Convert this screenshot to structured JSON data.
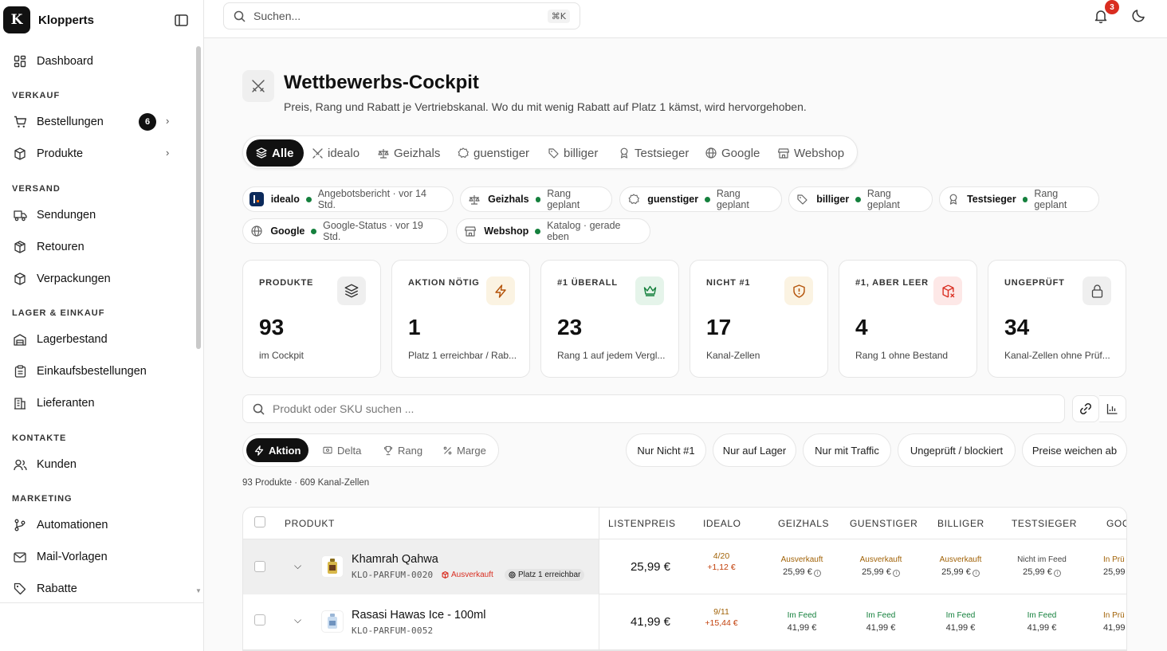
{
  "app": {
    "name": "Klopperts",
    "logo_letter": "K"
  },
  "sidebar": {
    "items": [
      {
        "label": "Dashboard"
      },
      {
        "label": "Bestellungen",
        "badge": "6"
      },
      {
        "label": "Produkte"
      },
      {
        "label": "Sendungen"
      },
      {
        "label": "Retouren"
      },
      {
        "label": "Verpackungen"
      },
      {
        "label": "Lagerbestand"
      },
      {
        "label": "Einkaufsbestellungen"
      },
      {
        "label": "Lieferanten"
      },
      {
        "label": "Kunden"
      },
      {
        "label": "Automationen"
      },
      {
        "label": "Mail-Vorlagen"
      },
      {
        "label": "Rabatte"
      }
    ],
    "sections": [
      "VERKAUF",
      "VERSAND",
      "LAGER & EINKAUF",
      "KONTAKTE",
      "MARKETING"
    ]
  },
  "topbar": {
    "search_placeholder": "Suchen...",
    "shortcut": "⌘K",
    "notifications": "3"
  },
  "header": {
    "title": "Wettbewerbs-Cockpit",
    "subtitle": "Preis, Rang und Rabatt je Vertriebskanal. Wo du mit wenig Rabatt auf Platz 1 kämst, wird hervorgehoben."
  },
  "tabs": [
    "Alle",
    "idealo",
    "Geizhals",
    "guenstiger",
    "billiger",
    "Testsieger",
    "Google",
    "Webshop"
  ],
  "chips": [
    {
      "name": "idealo",
      "status": "Angebotsbericht · vor 14 Std."
    },
    {
      "name": "Geizhals",
      "status": "Rang geplant"
    },
    {
      "name": "guenstiger",
      "status": "Rang geplant"
    },
    {
      "name": "billiger",
      "status": "Rang geplant"
    },
    {
      "name": "Testsieger",
      "status": "Rang geplant"
    },
    {
      "name": "Google",
      "status": "Google-Status · vor 19 Std."
    },
    {
      "name": "Webshop",
      "status": "Katalog · gerade eben"
    }
  ],
  "kpis": [
    {
      "label": "PRODUKTE",
      "value": "93",
      "sub": "im Cockpit"
    },
    {
      "label": "AKTION NÖTIG",
      "value": "1",
      "sub": "Platz 1 erreichbar / Rab..."
    },
    {
      "label": "#1 ÜBERALL",
      "value": "23",
      "sub": "Rang 1 auf jedem Vergl..."
    },
    {
      "label": "NICHT #1",
      "value": "17",
      "sub": "Kanal-Zellen"
    },
    {
      "label": "#1, ABER LEER",
      "value": "4",
      "sub": "Rang 1 ohne Bestand"
    },
    {
      "label": "UNGEPRÜFT",
      "value": "34",
      "sub": "Kanal-Zellen ohne Prüf..."
    }
  ],
  "product_search": {
    "placeholder": "Produkt oder SKU suchen ..."
  },
  "sort": [
    "Aktion",
    "Delta",
    "Rang",
    "Marge"
  ],
  "filters": [
    "Nur Nicht #1",
    "Nur auf Lager",
    "Nur mit Traffic",
    "Ungeprüft / blockiert",
    "Preise weichen ab"
  ],
  "count_text": "93 Produkte · 609 Kanal-Zellen",
  "table": {
    "headers": [
      "PRODUKT",
      "LISTENPREIS",
      "IDEALO",
      "GEIZHALS",
      "GUENSTIGER",
      "BILLIGER",
      "TESTSIEGER",
      "GOC"
    ],
    "rows": [
      {
        "name": "Khamrah Qahwa",
        "sku": "KLO-PARFUM-0020",
        "tag_stock": "Ausverkauft",
        "tag_rank": "Platz 1 erreichbar",
        "price": "25,99 €",
        "idealo_rank": "4/20",
        "idealo_delta": "+1,12 €",
        "cells": [
          {
            "status": "Ausverkauft",
            "price": "25,99 €"
          },
          {
            "status": "Ausverkauft",
            "price": "25,99 €"
          },
          {
            "status": "Ausverkauft",
            "price": "25,99 €"
          },
          {
            "status": "Nicht im Feed",
            "price": "25,99 €"
          },
          {
            "status": "In Prü",
            "price": "25,99"
          }
        ]
      },
      {
        "name": "Rasasi Hawas Ice - 100ml",
        "sku": "KLO-PARFUM-0052",
        "price": "41,99 €",
        "idealo_rank": "9/11",
        "idealo_delta": "+15,44 €",
        "cells": [
          {
            "status": "Im Feed",
            "price": "41,99 €"
          },
          {
            "status": "Im Feed",
            "price": "41,99 €"
          },
          {
            "status": "Im Feed",
            "price": "41,99 €"
          },
          {
            "status": "Im Feed",
            "price": "41,99 €"
          },
          {
            "status": "In Prü",
            "price": "41,99"
          }
        ]
      }
    ]
  },
  "colors": {
    "accent": "#111111",
    "success": "#15803d",
    "warning": "#a16207",
    "danger": "#d92d20",
    "bg": "#fafafa"
  }
}
